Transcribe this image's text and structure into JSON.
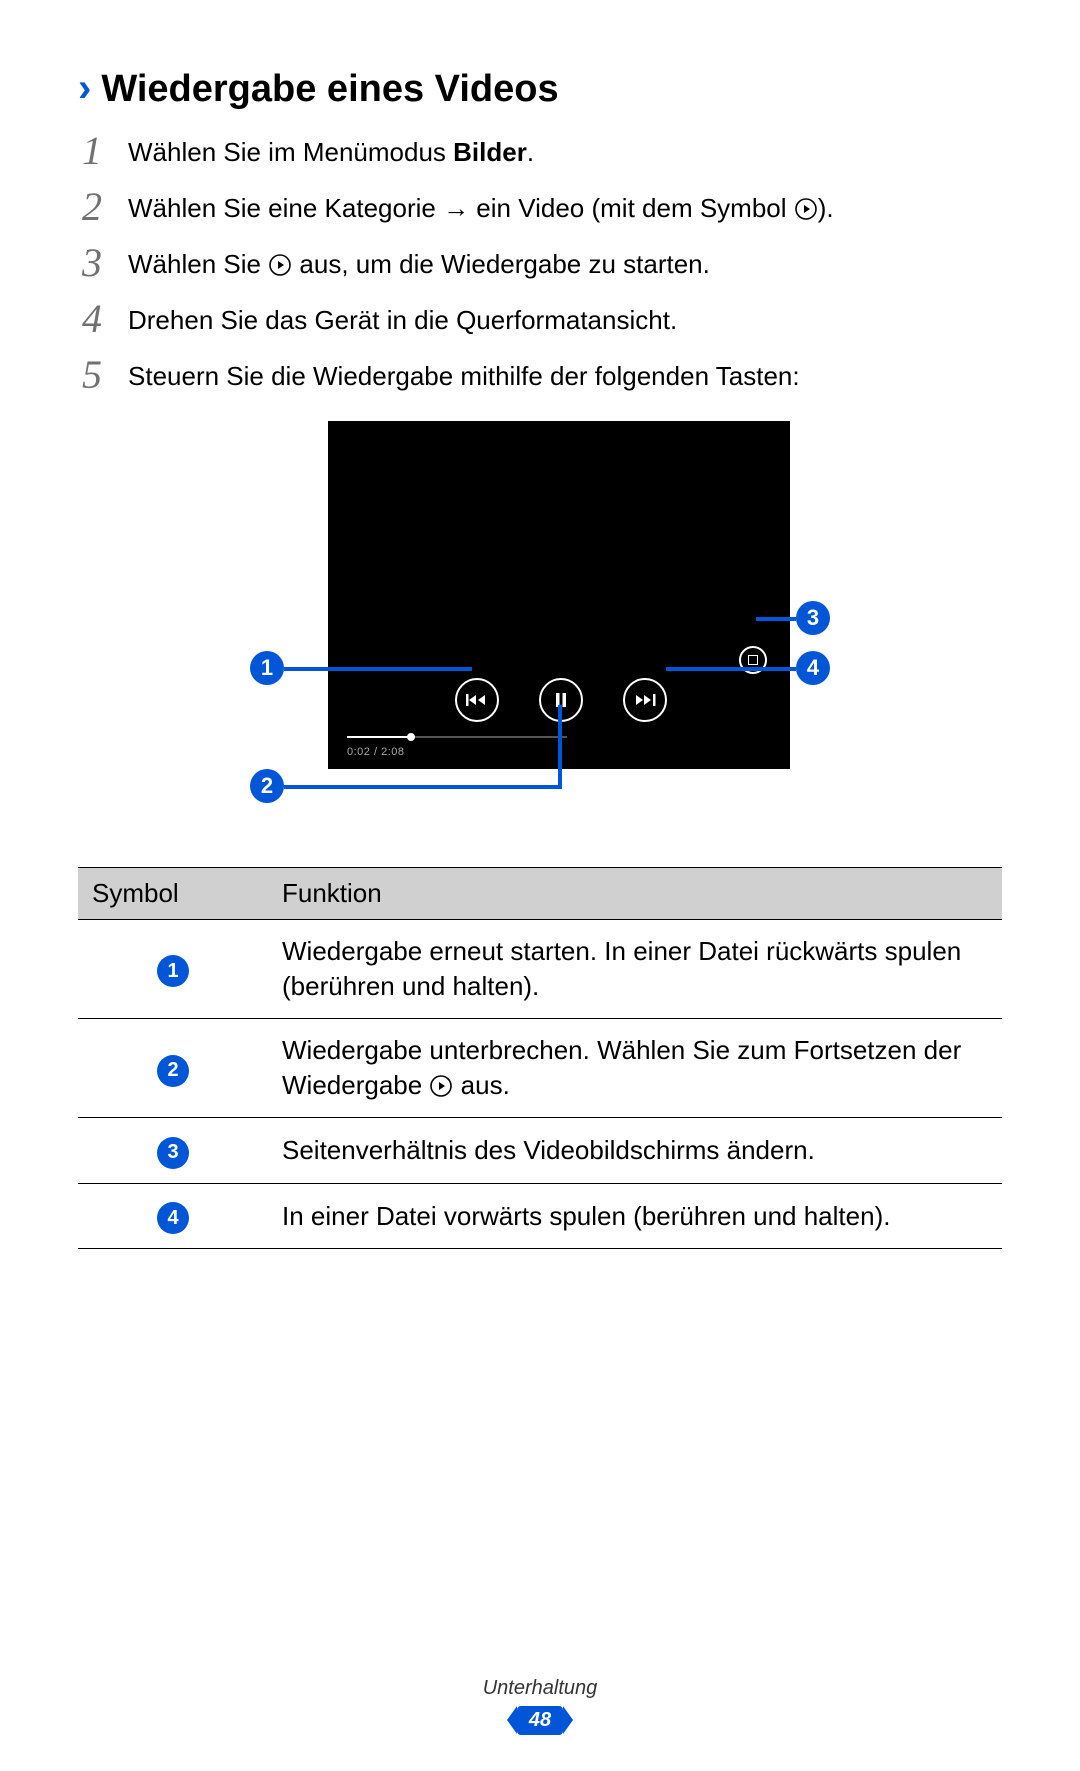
{
  "heading": {
    "chevron": "›",
    "title": "Wiedergabe eines Videos"
  },
  "steps": [
    {
      "num": "1",
      "pre": "Wählen Sie im Menümodus ",
      "bold": "Bilder",
      "post": "."
    },
    {
      "num": "2",
      "pre": "Wählen Sie eine Kategorie → ein Video (mit dem Symbol ",
      "icon": "play-circle",
      "post": ")."
    },
    {
      "num": "3",
      "pre": "Wählen Sie ",
      "icon": "play-circle",
      "post": " aus, um die Wiedergabe zu starten."
    },
    {
      "num": "4",
      "pre": "Drehen Sie das Gerät in die Querformatansicht."
    },
    {
      "num": "5",
      "pre": "Steuern Sie die Wiedergabe mithilfe der folgenden Tasten:"
    }
  ],
  "player": {
    "timecode": "0:02 / 2:08"
  },
  "callouts": {
    "c1": "1",
    "c2": "2",
    "c3": "3",
    "c4": "4"
  },
  "table": {
    "head": {
      "symbol": "Symbol",
      "funktion": "Funktion"
    },
    "rows": [
      {
        "n": "1",
        "text": "Wiedergabe erneut starten. In einer Datei rückwärts spulen (berühren und halten)."
      },
      {
        "n": "2",
        "pre": "Wiedergabe unterbrechen. Wählen Sie zum Fortsetzen der Wiedergabe ",
        "icon": "play-circle",
        "post": " aus."
      },
      {
        "n": "3",
        "text": "Seitenverhältnis des Videobildschirms ändern."
      },
      {
        "n": "4",
        "text": "In einer Datei vorwärts spulen (berühren und halten)."
      }
    ]
  },
  "footer": {
    "category": "Unterhaltung",
    "page": "48"
  }
}
